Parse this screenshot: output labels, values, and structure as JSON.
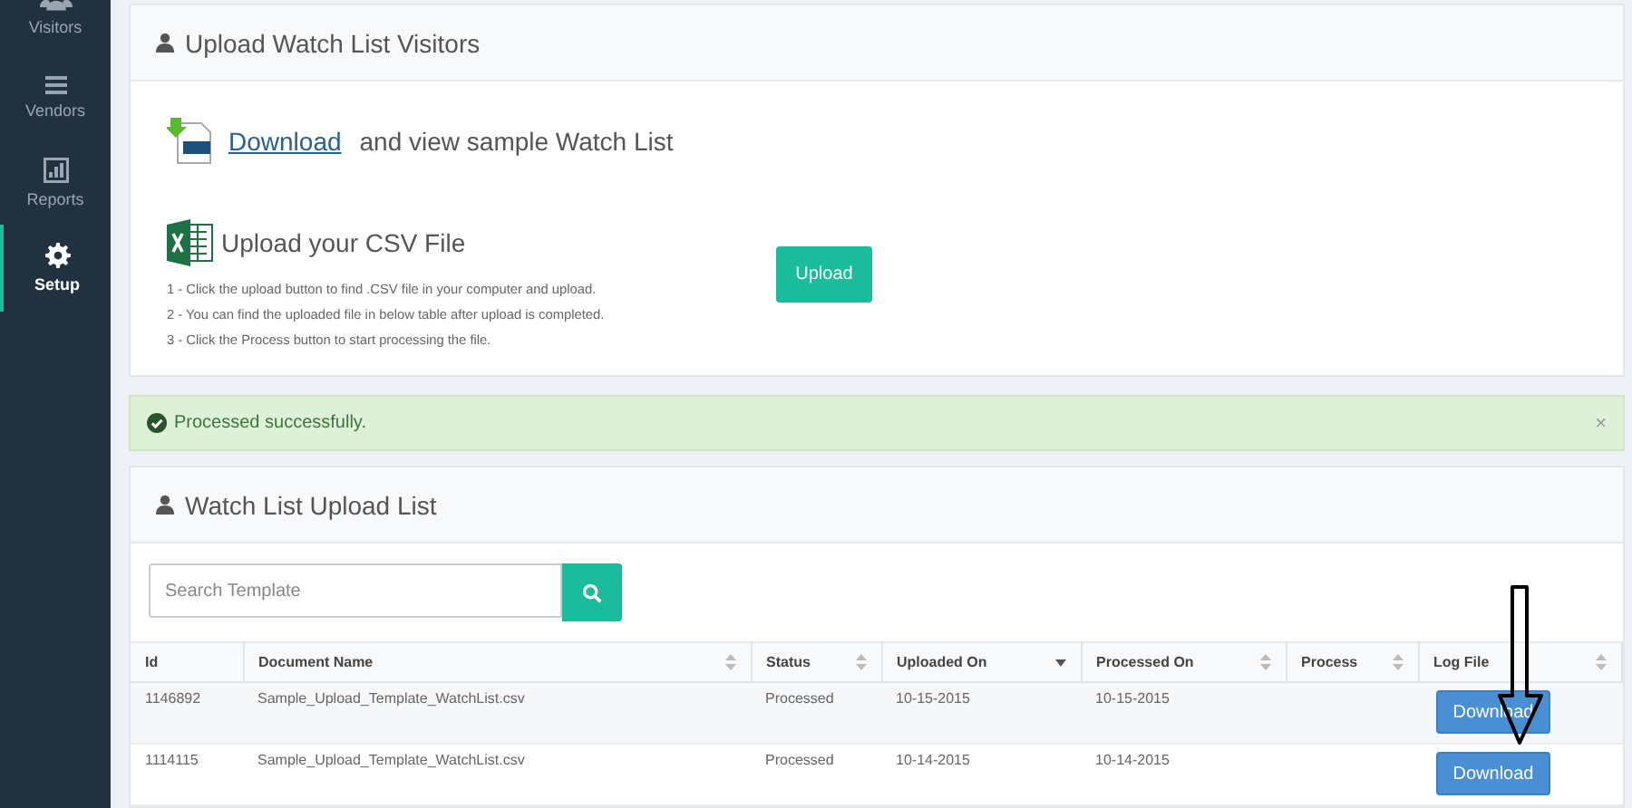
{
  "sidebar": {
    "items": [
      {
        "label": "Visitors",
        "kind": "users",
        "selected": false
      },
      {
        "label": "Vendors",
        "kind": "list",
        "selected": false
      },
      {
        "label": "Reports",
        "kind": "chart",
        "selected": false
      },
      {
        "label": "Setup",
        "kind": "gear",
        "selected": true
      }
    ]
  },
  "upload_panel": {
    "title": "Upload Watch List Visitors",
    "download_link": "Download",
    "download_text": "and view sample Watch List",
    "upload_title": "Upload your CSV File",
    "steps": [
      "1 - Click the upload button to find .CSV file in your computer and upload.",
      "2 - You can find the uploaded file in below table after upload is completed.",
      "3 - Click the Process button to start processing the file."
    ],
    "upload_button": "Upload"
  },
  "alert": {
    "message": "Processed successfully.",
    "close": "×"
  },
  "list_panel": {
    "title": "Watch List Upload List",
    "search": {
      "placeholder": "Search Template"
    },
    "table": {
      "columns": [
        {
          "label": "Id",
          "kind": "plain"
        },
        {
          "label": "Document Name",
          "kind": "sortable"
        },
        {
          "label": "Status",
          "kind": "sortable"
        },
        {
          "label": "Uploaded On",
          "kind": "sorted"
        },
        {
          "label": "Processed On",
          "kind": "sortable"
        },
        {
          "label": "Process",
          "kind": "sortable"
        },
        {
          "label": "Log File",
          "kind": "sortable"
        }
      ],
      "rows": [
        {
          "id": "1146892",
          "document_name": "Sample_Upload_Template_WatchList.csv",
          "status": "Processed",
          "uploaded_on": "10-15-2015",
          "processed_on": "10-15-2015",
          "log_file": "Download"
        },
        {
          "id": "1114115",
          "document_name": "Sample_Upload_Template_WatchList.csv",
          "status": "Processed",
          "uploaded_on": "10-14-2015",
          "processed_on": "10-14-2015",
          "log_file": "Download"
        }
      ]
    }
  }
}
